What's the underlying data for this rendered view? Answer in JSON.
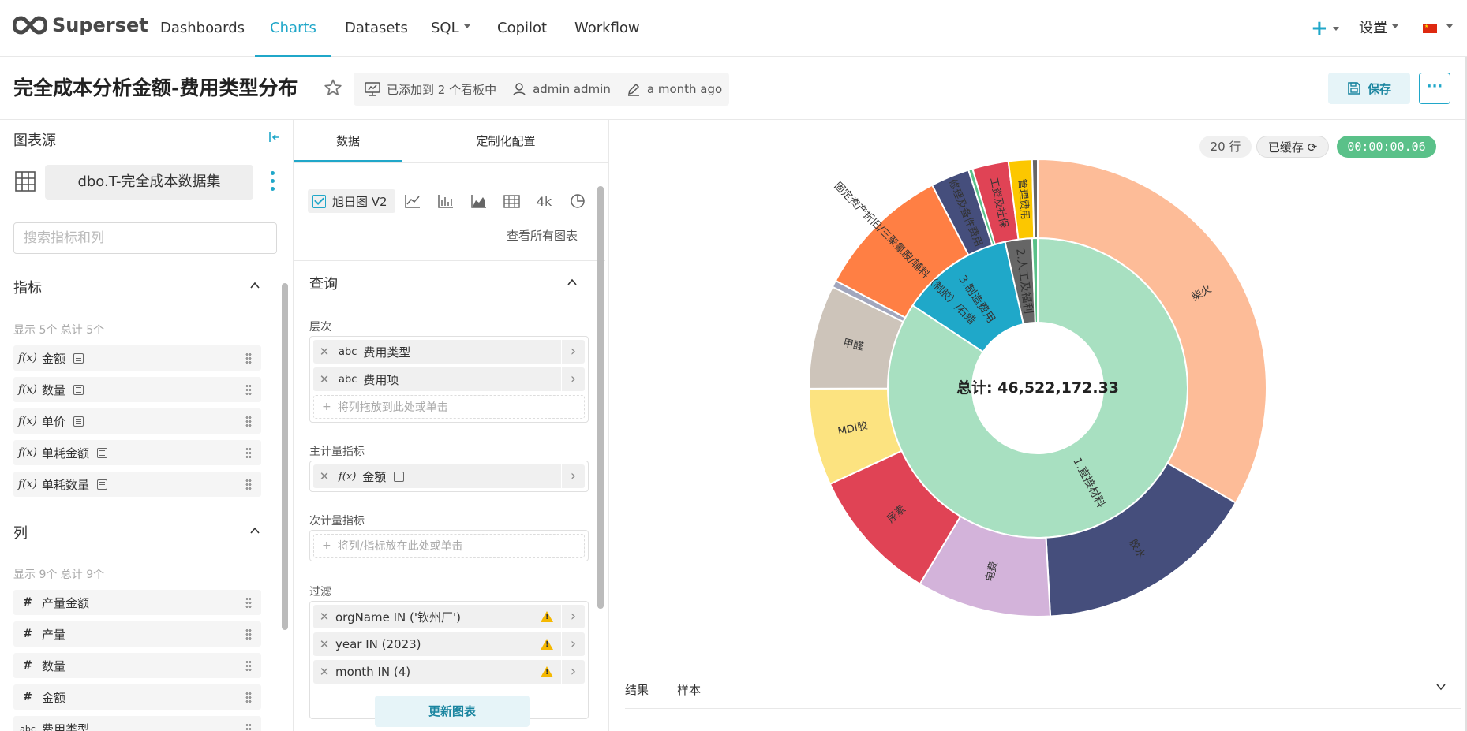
{
  "nav": {
    "brand": "Superset",
    "items": [
      "Dashboards",
      "Charts",
      "Datasets",
      "SQL",
      "Copilot",
      "Workflow"
    ],
    "plus": "+",
    "settings": "设置"
  },
  "header": {
    "title": "完全成本分析金额-费用类型分布",
    "dashboards": "已添加到 2 个看板中",
    "owner": "admin admin",
    "modified": "a month ago",
    "save": "保存",
    "more": "···"
  },
  "datasource": {
    "title": "图表源",
    "dataset": "dbo.T-完全成本数据集",
    "search_placeholder": "搜索指标和列",
    "metrics_title": "指标",
    "metrics_count": "显示 5个 总计 5个",
    "metrics": [
      "金额",
      "数量",
      "单价",
      "单耗金额",
      "单耗数量"
    ],
    "fx": "f(x)",
    "columns_title": "列",
    "columns_count": "显示 9个 总计 9个",
    "columns": [
      "产量金额",
      "产量",
      "数量",
      "金额",
      "费用类型"
    ],
    "hash": "#",
    "abc": "abc"
  },
  "controls": {
    "tab_data": "数据",
    "tab_custom": "定制化配置",
    "viz_name": "旭日图 V2",
    "viz_4k": "4k",
    "view_all": "查看所有图表",
    "query": "查询",
    "hierarchy_label": "层次",
    "hierarchy": [
      "费用类型",
      "费用项"
    ],
    "hierarchy_drop": "将列拖放到此处或单击",
    "primary_label": "主计量指标",
    "primary_metric": "金额",
    "secondary_label": "次计量指标",
    "secondary_drop": "将列/指标放在此处或单击",
    "filter_label": "过滤",
    "filters": [
      "orgName IN ('钦州厂')",
      "year IN (2023)",
      "month IN (4)"
    ],
    "run": "更新图表"
  },
  "status": {
    "rows": "20 行",
    "cached": "已缓存",
    "time": "00:00:00.06"
  },
  "results": {
    "tab_results": "结果",
    "tab_samples": "样本"
  },
  "chart_data": {
    "type": "sunburst",
    "center_label": "总计: 46,522,172.33",
    "inner": [
      {
        "name": "1.直接材料",
        "value": 0.843,
        "color": "#a8e0c1"
      },
      {
        "name": "3.制造费用",
        "value": 0.122,
        "color": "#1fa8c9"
      },
      {
        "name": "2.人工及福利",
        "value": 0.029,
        "color": "#666666"
      },
      {
        "name": "",
        "value": 0.006,
        "color": "#5ac189"
      }
    ],
    "outer": [
      {
        "name": "柴火",
        "value": 0.341,
        "color": "#fdbc98"
      },
      {
        "name": "胶水",
        "value": 0.161,
        "color": "#454e7c"
      },
      {
        "name": "电费",
        "value": 0.097,
        "color": "#d3b3da"
      },
      {
        "name": "尿素",
        "value": 0.097,
        "color": "#e04355"
      },
      {
        "name": "MDI胶",
        "value": 0.07,
        "color": "#fce380"
      },
      {
        "name": "甲醛",
        "value": 0.075,
        "color": "#cdc4ba"
      },
      {
        "name": "",
        "value": 0.005,
        "color": "#a1a6bd"
      },
      {
        "name": "固定资产折旧/三聚氰胺/辅料（制胶）/石蜡",
        "value": 0.098,
        "color": "#ff7f44"
      },
      {
        "name": "修理及备件费用",
        "value": 0.028,
        "color": "#454e7c"
      },
      {
        "name": "",
        "value": 0.003,
        "color": "#5ac189"
      },
      {
        "name": "工资及社保",
        "value": 0.026,
        "color": "#e04355"
      },
      {
        "name": "管理费用",
        "value": 0.017,
        "color": "#fcc700"
      },
      {
        "name": "",
        "value": 0.004,
        "color": "#666666"
      }
    ]
  }
}
